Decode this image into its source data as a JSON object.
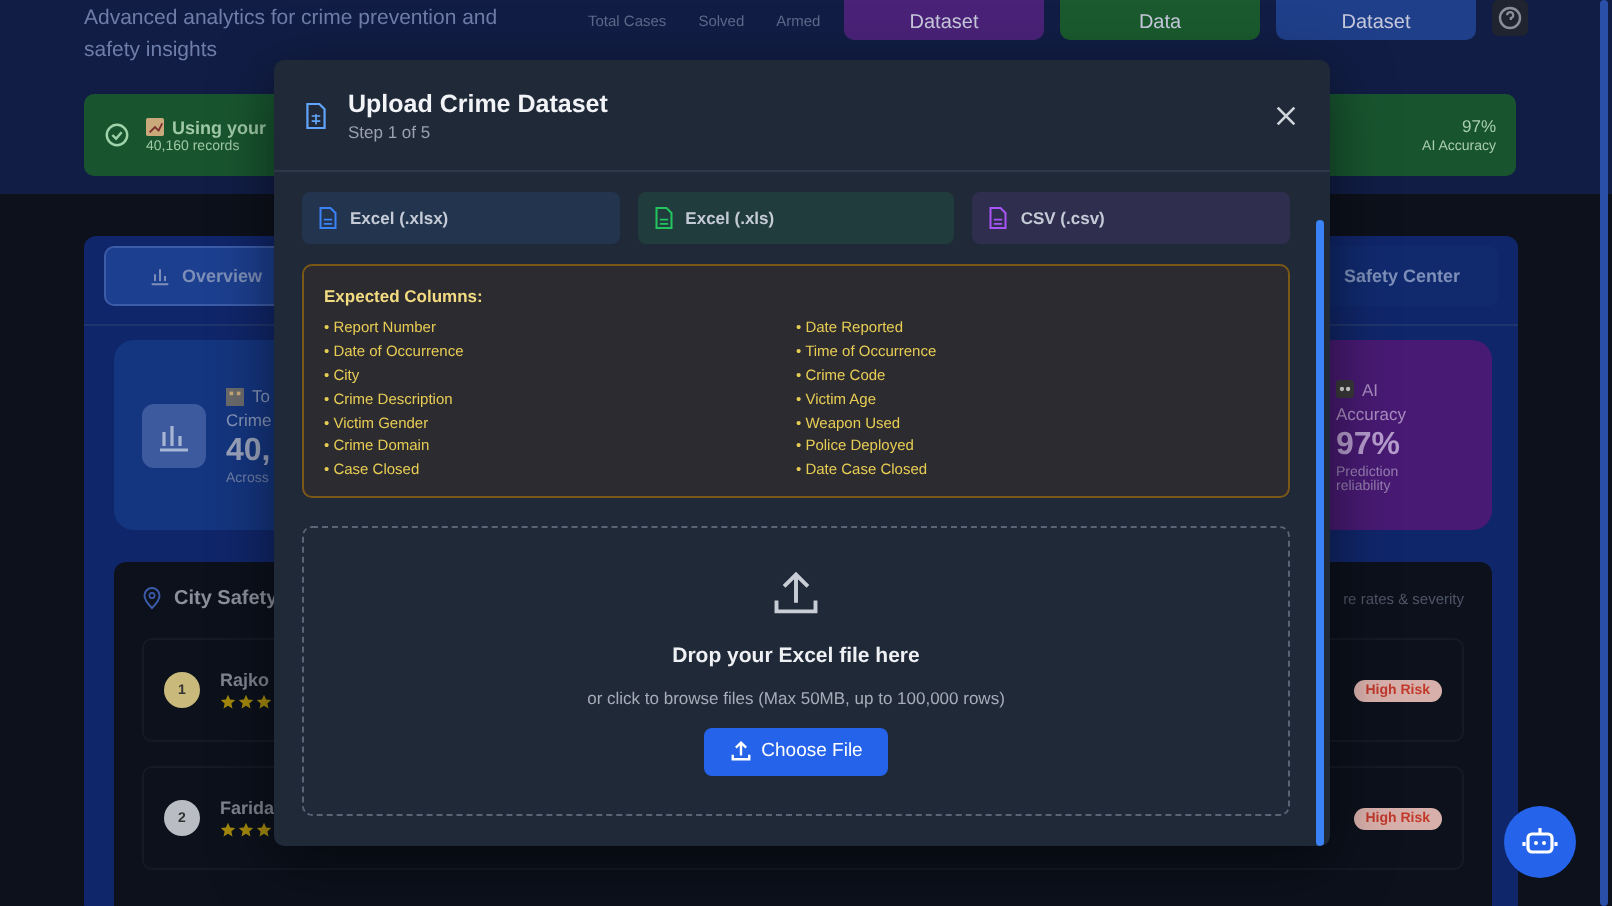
{
  "header": {
    "subtitle": "Advanced analytics for crime prevention and safety insights",
    "stats": [
      {
        "label": "Total Cases"
      },
      {
        "label": "Solved"
      },
      {
        "label": "Armed"
      }
    ],
    "buttons": [
      {
        "label": "Dataset",
        "color": "#4a2278"
      },
      {
        "label": "Data",
        "color": "#1a5a2e"
      },
      {
        "label": "Dataset",
        "color": "#1f3f8a"
      }
    ]
  },
  "banner": {
    "title": "Using your",
    "detail": "40,160 records",
    "value": "97%",
    "value_label": "AI Accuracy"
  },
  "tabs": [
    {
      "label": "Overview",
      "selected": true
    },
    {
      "label": "Safety Center",
      "selected": false
    }
  ],
  "cards": [
    {
      "kind": "total",
      "line1": "To",
      "line2": "Crime",
      "value": "40,",
      "caption": "Across"
    },
    {
      "kind": "accuracy",
      "line1": "AI",
      "line2": "Accuracy",
      "value": "97%",
      "caption": "Prediction reliability"
    }
  ],
  "city_safety": {
    "title": "City Safety",
    "subtitle": "re rates & severity",
    "rows": [
      {
        "rank": "1",
        "name": "Rajko",
        "stars": 3,
        "risk": "High Risk",
        "color": "#c9b97a"
      },
      {
        "rank": "2",
        "name": "Farida",
        "stars": 3,
        "risk": "High Risk",
        "color": "#b9bcc2"
      }
    ]
  },
  "modal": {
    "title": "Upload Crime Dataset",
    "step": "Step 1 of 5",
    "formats": [
      {
        "label": "Excel (.xlsx)",
        "color": "#3b82f6"
      },
      {
        "label": "Excel (.xls)",
        "color": "#22c55e"
      },
      {
        "label": "CSV (.csv)",
        "color": "#a855f7"
      }
    ],
    "columns_title": "Expected Columns:",
    "columns": [
      "• Report Number",
      "• Date Reported",
      "• Date of Occurrence",
      "• Time of Occurrence",
      "• City",
      "• Crime Code",
      "• Crime Description",
      "• Victim Age",
      "• Victim Gender",
      "• Weapon Used",
      "• Crime Domain",
      "• Police Deployed",
      "• Case Closed",
      "• Date Case Closed"
    ],
    "drop_title": "Drop your Excel file here",
    "drop_hint": "or click to browse files (Max 50MB, up to 100,000 rows)",
    "button": "Choose File"
  }
}
